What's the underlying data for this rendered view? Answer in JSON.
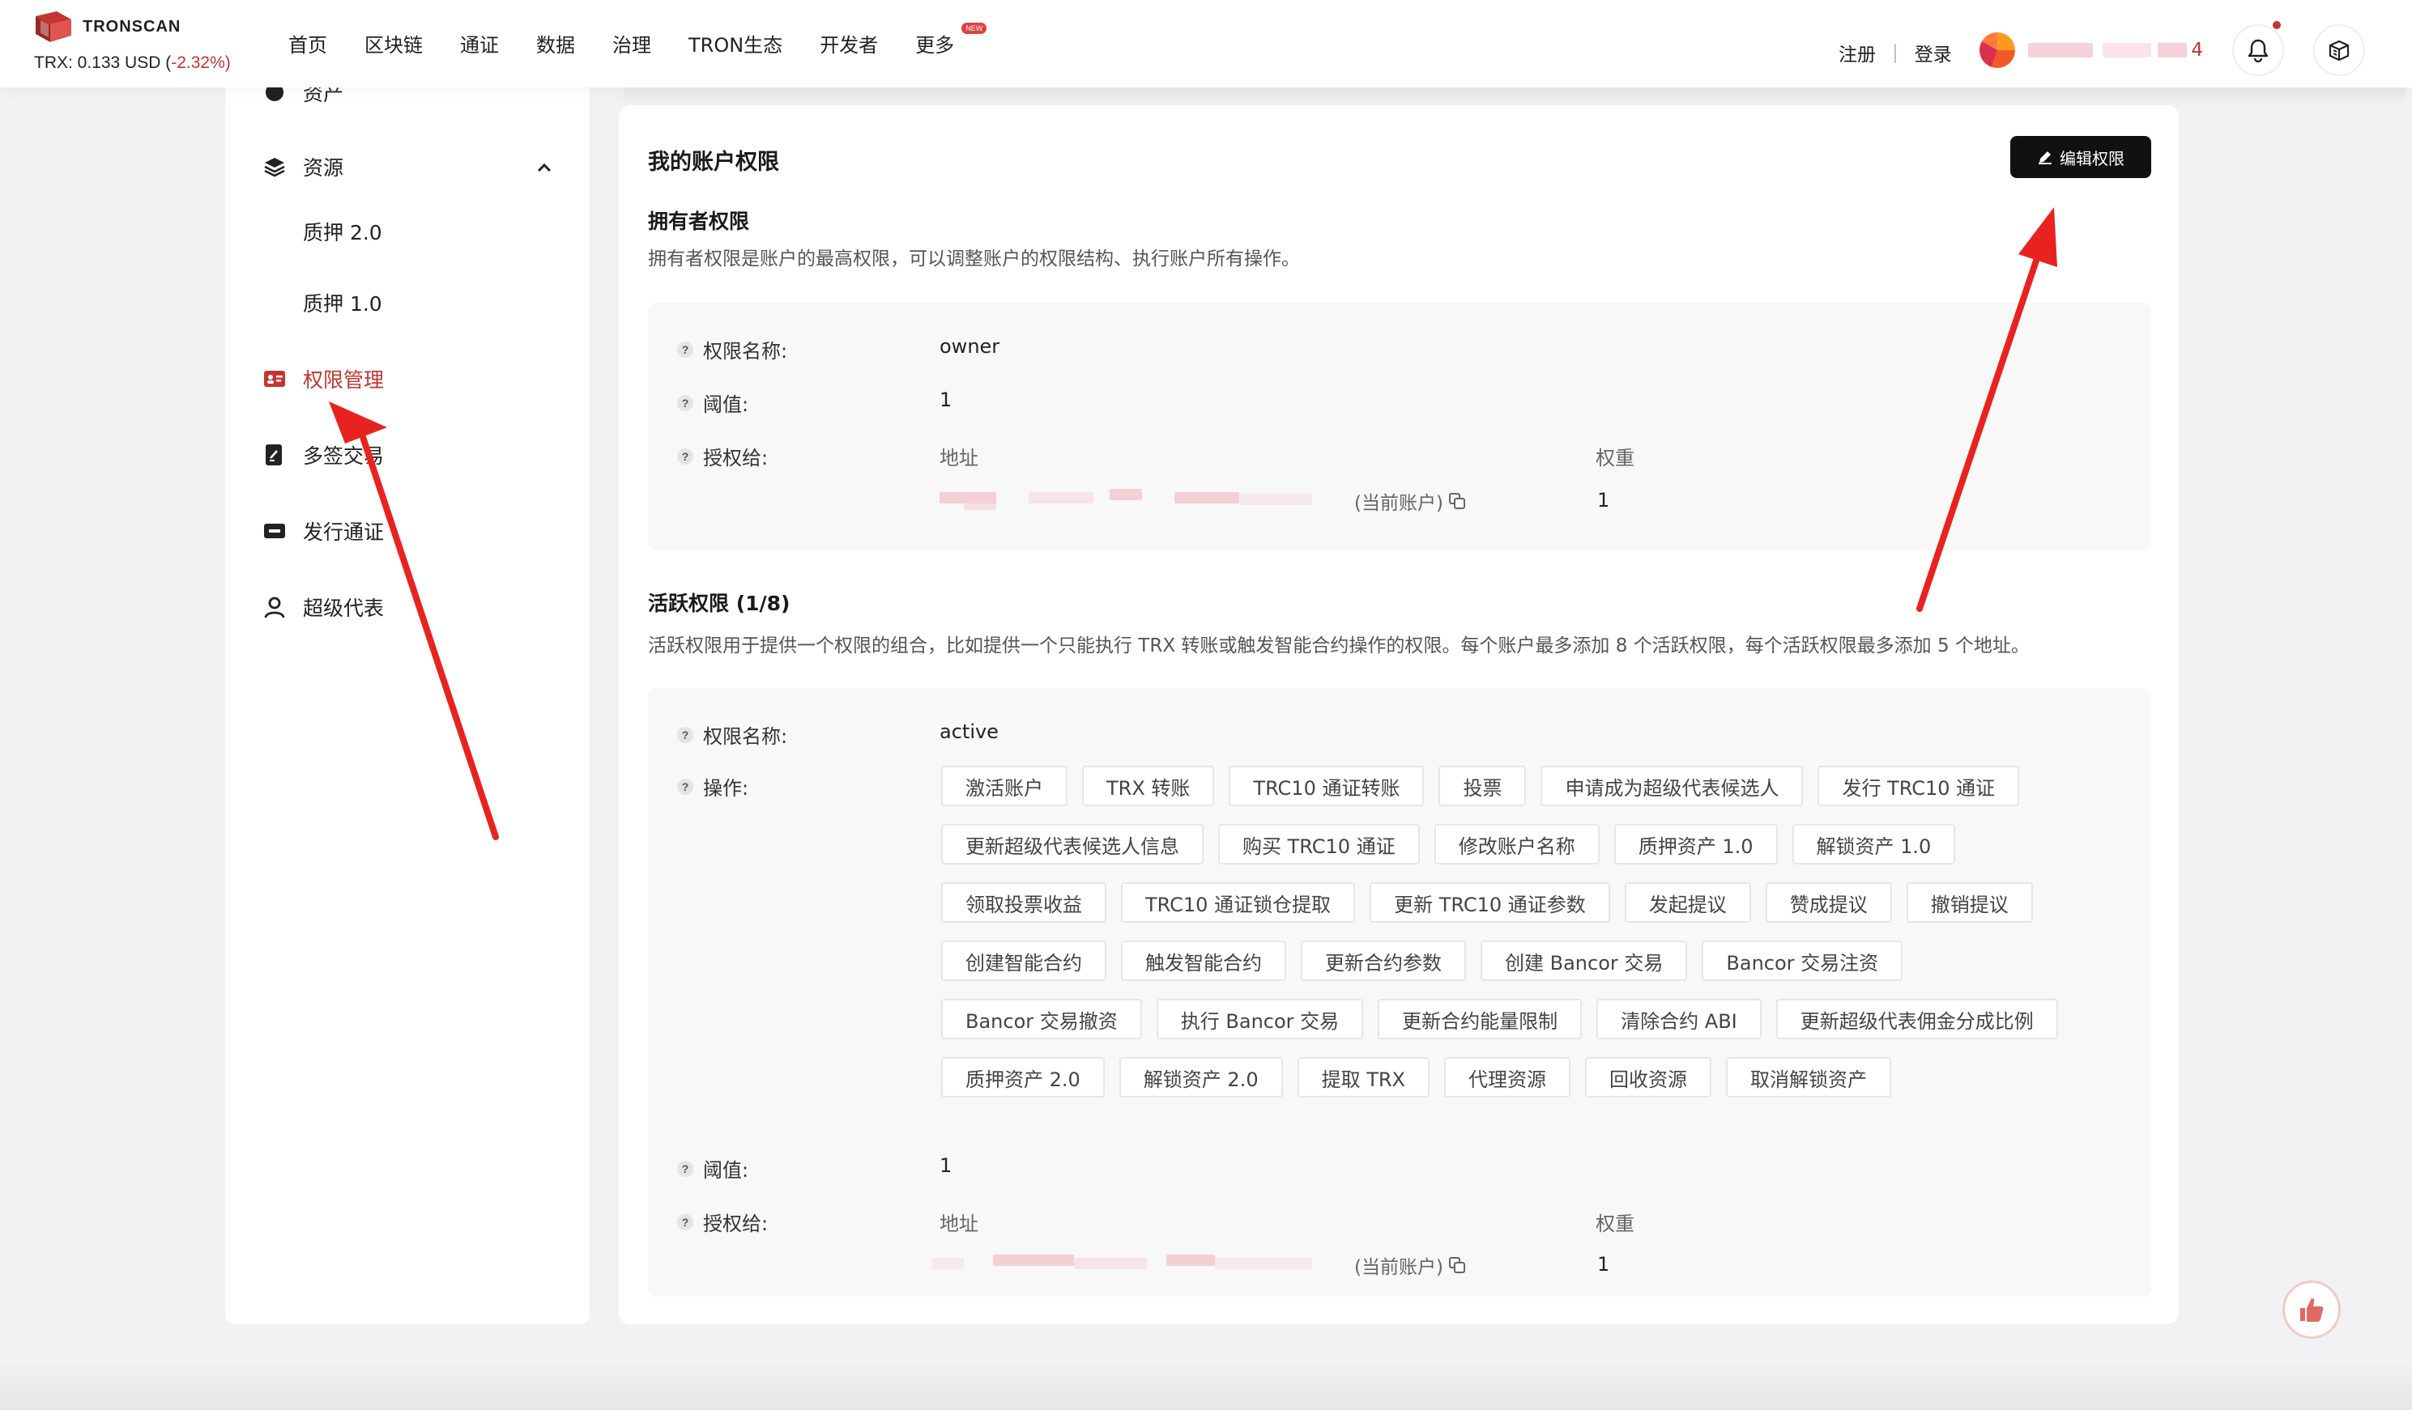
{
  "header": {
    "logo_text": "TRONSCAN",
    "price_label": "TRX: 0.133 USD (",
    "price_change": "-2.32%",
    "price_close": ")",
    "nav": [
      "首页",
      "区块链",
      "通证",
      "数据",
      "治理",
      "TRON生态",
      "开发者",
      "更多"
    ],
    "new_badge": "NEW",
    "register": "注册",
    "separator": "|",
    "login": "登录",
    "user_address_suffix": "4"
  },
  "sidebar": {
    "items": [
      {
        "label": "资产",
        "icon": "pie-chart-icon"
      },
      {
        "label": "资源",
        "icon": "layers-icon"
      },
      {
        "label": "质押 2.0"
      },
      {
        "label": "质押 1.0"
      },
      {
        "label": "权限管理",
        "icon": "id-card-icon"
      },
      {
        "label": "多签交易",
        "icon": "sign-doc-icon"
      },
      {
        "label": "发行通证",
        "icon": "token-icon"
      },
      {
        "label": "超级代表",
        "icon": "user-icon"
      }
    ]
  },
  "main": {
    "title": "我的账户权限",
    "edit_button": "编辑权限",
    "owner": {
      "title": "拥有者权限",
      "desc": "拥有者权限是账户的最高权限，可以调整账户的权限结构、执行账户所有操作。",
      "name_label": "权限名称:",
      "name_value": "owner",
      "threshold_label": "阈值:",
      "threshold_value": "1",
      "grant_label": "授权给:",
      "addr_head": "地址",
      "weight_head": "权重",
      "current": "(当前账户)",
      "weight_value": "1"
    },
    "active": {
      "title": "活跃权限  (1/8)",
      "desc": "活跃权限用于提供一个权限的组合，比如提供一个只能执行 TRX 转账或触发智能合约操作的权限。每个账户最多添加 8 个活跃权限，每个活跃权限最多添加 5 个地址。",
      "name_label": "权限名称:",
      "name_value": "active",
      "ops_label": "操作:",
      "operations": [
        [
          "激活账户",
          "TRX 转账",
          "TRC10 通证转账",
          "投票",
          "申请成为超级代表候选人",
          "发行 TRC10 通证"
        ],
        [
          "更新超级代表候选人信息",
          "购买 TRC10 通证",
          "修改账户名称",
          "质押资产 1.0",
          "解锁资产 1.0"
        ],
        [
          "领取投票收益",
          "TRC10 通证锁仓提取",
          "更新 TRC10 通证参数",
          "发起提议",
          "赞成提议",
          "撤销提议"
        ],
        [
          "创建智能合约",
          "触发智能合约",
          "更新合约参数",
          "创建 Bancor 交易",
          "Bancor 交易注资"
        ],
        [
          "Bancor 交易撤资",
          "执行 Bancor 交易",
          "更新合约能量限制",
          "清除合约 ABI",
          "更新超级代表佣金分成比例"
        ],
        [
          "质押资产 2.0",
          "解锁资产 2.0",
          "提取 TRX",
          "代理资源",
          "回收资源",
          "取消解锁资产"
        ]
      ],
      "threshold_label": "阈值:",
      "threshold_value": "1",
      "grant_label": "授权给:",
      "addr_head": "地址",
      "weight_head": "权重",
      "current": "(当前账户)",
      "weight_value": "1"
    }
  },
  "colors": {
    "accent": "#c23631",
    "annotation_arrow": "#e8231f",
    "button_dark": "#111111"
  }
}
